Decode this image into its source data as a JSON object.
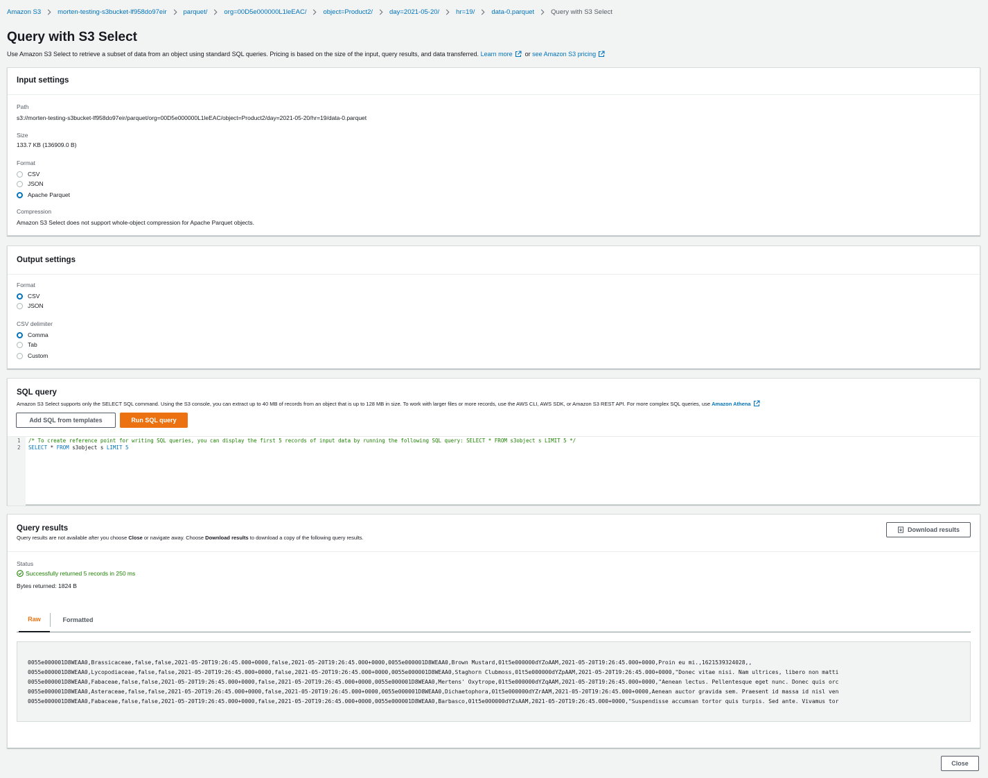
{
  "breadcrumb": [
    {
      "label": "Amazon S3"
    },
    {
      "label": "morten-testing-s3bucket-lf958do97eir"
    },
    {
      "label": "parquet/"
    },
    {
      "label": "org=00D5e000000L1leEAC/"
    },
    {
      "label": "object=Product2/"
    },
    {
      "label": "day=2021-05-20/"
    },
    {
      "label": "hr=19/"
    },
    {
      "label": "data-0.parquet"
    },
    {
      "label": "Query with S3 Select"
    }
  ],
  "page": {
    "title": "Query with S3 Select",
    "description": "Use Amazon S3 Select to retrieve a subset of data from an object using standard SQL queries. Pricing is based on the size of the input, query results, and data transferred.",
    "learn_more": "Learn more",
    "or_text": "or",
    "pricing_link": "see Amazon S3 pricing"
  },
  "input_settings": {
    "title": "Input settings",
    "path_label": "Path",
    "path_value": "s3://morten-testing-s3bucket-lf958do97eir/parquet/org=00D5e000000L1leEAC/object=Product2/day=2021-05-20/hr=19/data-0.parquet",
    "size_label": "Size",
    "size_value": "133.7 KB (136909.0 B)",
    "format_label": "Format",
    "format_options": [
      "CSV",
      "JSON",
      "Apache Parquet"
    ],
    "format_selected": "Apache Parquet",
    "compression_label": "Compression",
    "compression_value": "Amazon S3 Select does not support whole-object compression for Apache Parquet objects."
  },
  "output_settings": {
    "title": "Output settings",
    "format_label": "Format",
    "format_options": [
      "CSV",
      "JSON"
    ],
    "format_selected": "CSV",
    "delimiter_label": "CSV delimiter",
    "delimiter_options": [
      "Comma",
      "Tab",
      "Custom"
    ],
    "delimiter_selected": "Comma"
  },
  "sql_query": {
    "title": "SQL query",
    "description": "Amazon S3 Select supports only the SELECT SQL command. Using the S3 console, you can extract up to 40 MB of records from an object that is up to 128 MB in size. To work with larger files or more records, use the AWS CLI, AWS SDK, or Amazon S3 REST API. For more complex SQL queries, use",
    "athena_link": "Amazon Athena",
    "templates_button": "Add SQL from templates",
    "run_button": "Run SQL query",
    "line_numbers": [
      "1",
      "2"
    ],
    "line1": "/* To create reference point for writing SQL queries, you can display the first 5 records of input data by running the following SQL query: SELECT * FROM s3object s LIMIT 5 */",
    "line2_kw1": "SELECT",
    "line2_mid": " * ",
    "line2_kw2": "FROM",
    "line2_obj": " s3object s ",
    "line2_kw3": "LIMIT",
    "line2_num": " 5"
  },
  "query_results": {
    "title": "Query results",
    "desc_prefix": "Query results are not available after you choose",
    "desc_close": "Close",
    "desc_mid": "or navigate away. Choose",
    "desc_download": "Download results",
    "desc_suffix": "to download a copy of the following query results.",
    "download_button": "Download results",
    "status_label": "Status",
    "status_value": "Successfully returned 5 records in 250 ms",
    "bytes_returned": "Bytes returned: 1824 B",
    "tabs": [
      "Raw",
      "Formatted"
    ],
    "active_tab": "Raw",
    "raw_lines": [
      "0055e000001D8WEAA0,Brassicaceae,false,false,2021-05-20T19:26:45.000+0000,false,2021-05-20T19:26:45.000+0000,0055e000001D8WEAA0,Brown Mustard,01t5e000000dYZoAAM,2021-05-20T19:26:45.000+0000,Proin eu mi.,1621539324028,,",
      "0055e000001D8WEAA0,Lycopodiaceae,false,false,2021-05-20T19:26:45.000+0000,false,2021-05-20T19:26:45.000+0000,0055e000001D8WEAA0,Staghorn Clubmoss,01t5e000000dYZpAAM,2021-05-20T19:26:45.000+0000,\"Donec vitae nisi. Nam ultrices, libero non matti",
      "0055e000001D8WEAA0,Fabaceae,false,false,2021-05-20T19:26:45.000+0000,false,2021-05-20T19:26:45.000+0000,0055e000001D8WEAA0,Mertens' Oxytrope,01t5e000000dYZqAAM,2021-05-20T19:26:45.000+0000,\"Aenean lectus. Pellentesque eget nunc. Donec quis orc",
      "0055e000001D8WEAA0,Asteraceae,false,false,2021-05-20T19:26:45.000+0000,false,2021-05-20T19:26:45.000+0000,0055e000001D8WEAA0,Dichaetophora,01t5e000000dYZrAAM,2021-05-20T19:26:45.000+0000,Aenean auctor gravida sem. Praesent id massa id nisl ven",
      "0055e000001D8WEAA0,Fabaceae,false,false,2021-05-20T19:26:45.000+0000,false,2021-05-20T19:26:45.000+0000,0055e000001D8WEAA0,Barbasco,01t5e000000dYZsAAM,2021-05-20T19:26:45.000+0000,\"Suspendisse accumsan tortor quis turpis. Sed ante. Vivamus tor"
    ]
  },
  "footer": {
    "close_button": "Close"
  },
  "colors": {
    "link": "#0073bb",
    "primary_button": "#ec7211",
    "success": "#1d8102",
    "background": "#f2f3f3"
  },
  "icons": [
    "chevron-right-icon",
    "external-link-icon",
    "status-success-icon",
    "download-icon"
  ]
}
